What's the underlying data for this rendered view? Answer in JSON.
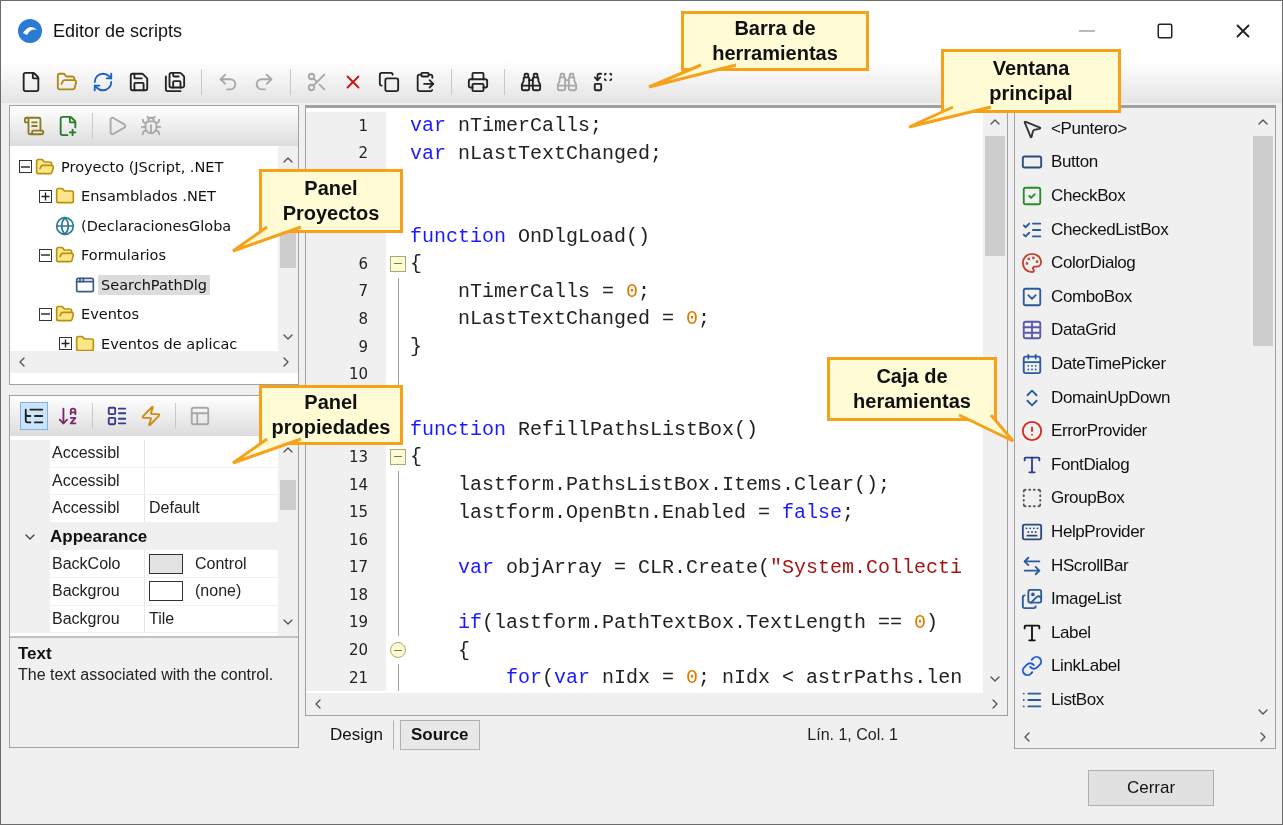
{
  "window": {
    "title": "Editor de scripts"
  },
  "toolbar": [
    {
      "kind": "new",
      "disabled": false
    },
    {
      "kind": "open",
      "disabled": false
    },
    {
      "kind": "reload",
      "disabled": false
    },
    {
      "kind": "save",
      "disabled": false
    },
    {
      "kind": "save-all",
      "disabled": false
    },
    {
      "kind": "separator"
    },
    {
      "kind": "undo",
      "disabled": true
    },
    {
      "kind": "redo",
      "disabled": true
    },
    {
      "kind": "separator"
    },
    {
      "kind": "cut",
      "disabled": true
    },
    {
      "kind": "delete",
      "disabled": false
    },
    {
      "kind": "copy",
      "disabled": false
    },
    {
      "kind": "paste",
      "disabled": false
    },
    {
      "kind": "separator"
    },
    {
      "kind": "print",
      "disabled": false
    },
    {
      "kind": "separator"
    },
    {
      "kind": "find",
      "disabled": false
    },
    {
      "kind": "find-next",
      "disabled": true
    },
    {
      "kind": "replace",
      "disabled": false
    }
  ],
  "project_panel": {
    "toolbar": [
      {
        "kind": "add-script",
        "disabled": false
      },
      {
        "kind": "add-form",
        "disabled": false
      },
      {
        "kind": "separator"
      },
      {
        "kind": "run",
        "disabled": true
      },
      {
        "kind": "debug",
        "disabled": true
      }
    ],
    "tree": [
      {
        "kind": "folder",
        "label": "Proyecto (JScript, .NET",
        "expanded": true,
        "selected": false,
        "children": [
          {
            "kind": "folder",
            "label": "Ensamblados .NET",
            "expanded": false,
            "selected": false
          },
          {
            "kind": "globals",
            "label": "(DeclaracionesGloba",
            "selected": false
          },
          {
            "kind": "folder",
            "label": "Formularios",
            "expanded": true,
            "selected": false,
            "children": [
              {
                "kind": "form",
                "label": "SearchPathDlg",
                "selected": true
              }
            ]
          },
          {
            "kind": "folder",
            "label": "Eventos",
            "expanded": true,
            "selected": false,
            "children": [
              {
                "kind": "folder",
                "label": "Eventos de aplicac",
                "expanded": false,
                "selected": false
              }
            ]
          }
        ]
      }
    ]
  },
  "properties_panel": {
    "toolbar": [
      {
        "kind": "categorized",
        "selected": true,
        "disabled": false
      },
      {
        "kind": "alphabetical",
        "selected": false,
        "disabled": false
      },
      {
        "kind": "separator"
      },
      {
        "kind": "properties",
        "selected": false,
        "disabled": false
      },
      {
        "kind": "events",
        "selected": false,
        "disabled": false
      },
      {
        "kind": "separator"
      },
      {
        "kind": "pages",
        "selected": false,
        "disabled": true
      }
    ],
    "rows": [
      {
        "kind": "property",
        "name": "Accessibl"
      },
      {
        "kind": "property",
        "name": "Accessibl"
      },
      {
        "kind": "property",
        "name": "Accessibl",
        "value": "Default"
      },
      {
        "kind": "category",
        "name": "Appearance",
        "expanded": true
      },
      {
        "kind": "property",
        "name": "BackColo",
        "value": "Control",
        "color": "#e3e3e3"
      },
      {
        "kind": "property",
        "name": "Backgrou",
        "value": "(none)",
        "color": "#ffffff"
      },
      {
        "kind": "property",
        "name": "Backgrou",
        "value": "Tile"
      }
    ],
    "description": {
      "title": "Text",
      "text": "The text associated with the control."
    }
  },
  "editor": {
    "lines": [
      {
        "number": "1",
        "kind": "plain",
        "tokens": [
          {
            "kind": "keyword",
            "text": "var"
          },
          {
            "kind": "plain",
            "text": " nTimerCalls;"
          }
        ]
      },
      {
        "number": "2",
        "kind": "plain",
        "tokens": [
          {
            "kind": "keyword",
            "text": "var"
          },
          {
            "kind": "plain",
            "text": " nLastTextChanged;"
          }
        ]
      },
      {
        "kind": "plain"
      },
      {
        "kind": "plain"
      },
      {
        "kind": "plain",
        "tokens": [
          {
            "kind": "keyword",
            "text": "function"
          },
          {
            "kind": "plain",
            "text": " OnDlgLoad()"
          }
        ]
      },
      {
        "number": "6",
        "kind": "fold-start",
        "tokens": [
          {
            "kind": "plain",
            "text": "{"
          }
        ]
      },
      {
        "number": "7",
        "kind": "block",
        "tokens": [
          {
            "kind": "plain",
            "text": "    nTimerCalls = "
          },
          {
            "kind": "number",
            "text": "0"
          },
          {
            "kind": "plain",
            "text": ";"
          }
        ]
      },
      {
        "number": "8",
        "kind": "block",
        "tokens": [
          {
            "kind": "plain",
            "text": "    nLastTextChanged = "
          },
          {
            "kind": "number",
            "text": "0"
          },
          {
            "kind": "plain",
            "text": ";"
          }
        ]
      },
      {
        "number": "9",
        "kind": "block",
        "tokens": [
          {
            "kind": "plain",
            "text": "}"
          }
        ]
      },
      {
        "number": "10",
        "kind": "block"
      },
      {
        "kind": "plain"
      },
      {
        "kind": "plain",
        "tokens": [
          {
            "kind": "keyword",
            "text": "function"
          },
          {
            "kind": "plain",
            "text": " RefillPathsListBox()"
          }
        ]
      },
      {
        "number": "13",
        "kind": "fold-start",
        "tokens": [
          {
            "kind": "plain",
            "text": "{"
          }
        ]
      },
      {
        "number": "14",
        "kind": "block",
        "tokens": [
          {
            "kind": "plain",
            "text": "    lastform.PathsListBox.Items.Clear();"
          }
        ]
      },
      {
        "number": "15",
        "kind": "block",
        "tokens": [
          {
            "kind": "plain",
            "text": "    lastform.OpenBtn.Enabled = "
          },
          {
            "kind": "keyword",
            "text": "false"
          },
          {
            "kind": "plain",
            "text": ";"
          }
        ]
      },
      {
        "number": "16",
        "kind": "block"
      },
      {
        "number": "17",
        "kind": "block",
        "tokens": [
          {
            "kind": "keyword",
            "text": "    var"
          },
          {
            "kind": "plain",
            "text": " objArray = CLR.Create("
          },
          {
            "kind": "string",
            "text": "\"System.Collecti"
          }
        ]
      },
      {
        "number": "18",
        "kind": "block"
      },
      {
        "number": "19",
        "kind": "block",
        "tokens": [
          {
            "kind": "keyword",
            "text": "    if"
          },
          {
            "kind": "plain",
            "text": "(lastform.PathTextBox.TextLength == "
          },
          {
            "kind": "number",
            "text": "0"
          },
          {
            "kind": "plain",
            "text": ")"
          }
        ]
      },
      {
        "number": "20",
        "kind": "fold-start-round",
        "tokens": [
          {
            "kind": "plain",
            "text": "    {"
          }
        ]
      },
      {
        "number": "21",
        "kind": "block",
        "tokens": [
          {
            "kind": "keyword",
            "text": "        for"
          },
          {
            "kind": "plain",
            "text": "("
          },
          {
            "kind": "keyword",
            "text": "var"
          },
          {
            "kind": "plain",
            "text": " nIdx = "
          },
          {
            "kind": "number",
            "text": "0"
          },
          {
            "kind": "plain",
            "text": "; nIdx < astrPaths.len"
          }
        ]
      }
    ],
    "tabs": [
      {
        "label": "Design",
        "selected": false
      },
      {
        "label": "Source",
        "selected": true
      }
    ],
    "status": "Lín. 1, Col. 1"
  },
  "toolbox": {
    "items": [
      {
        "kind": "pointer",
        "label": "<Puntero>"
      },
      {
        "kind": "button",
        "label": "Button"
      },
      {
        "kind": "checkbox",
        "label": "CheckBox"
      },
      {
        "kind": "checked-list",
        "label": "CheckedListBox"
      },
      {
        "kind": "color-dialog",
        "label": "ColorDialog"
      },
      {
        "kind": "combo-box",
        "label": "ComboBox"
      },
      {
        "kind": "data-grid",
        "label": "DataGrid"
      },
      {
        "kind": "date-picker",
        "label": "DateTimePicker"
      },
      {
        "kind": "up-down",
        "label": "DomainUpDown"
      },
      {
        "kind": "error",
        "label": "ErrorProvider"
      },
      {
        "kind": "font-dialog",
        "label": "FontDialog"
      },
      {
        "kind": "group-box",
        "label": "GroupBox"
      },
      {
        "kind": "help",
        "label": "HelpProvider"
      },
      {
        "kind": "hscroll",
        "label": "HScrollBar"
      },
      {
        "kind": "image-list",
        "label": "ImageList"
      },
      {
        "kind": "label",
        "label": "Label"
      },
      {
        "kind": "link-label",
        "label": "LinkLabel"
      },
      {
        "kind": "list-box",
        "label": "ListBox"
      }
    ]
  },
  "footer": {
    "button": "Cerrar"
  },
  "callouts": [
    {
      "text": "Barra de\nherramientas"
    },
    {
      "text": "Ventana\nprincipal"
    },
    {
      "text": "Panel\nProyectos"
    },
    {
      "text": "Caja de\nheramientas"
    },
    {
      "text": "Panel\npropiedades"
    }
  ]
}
